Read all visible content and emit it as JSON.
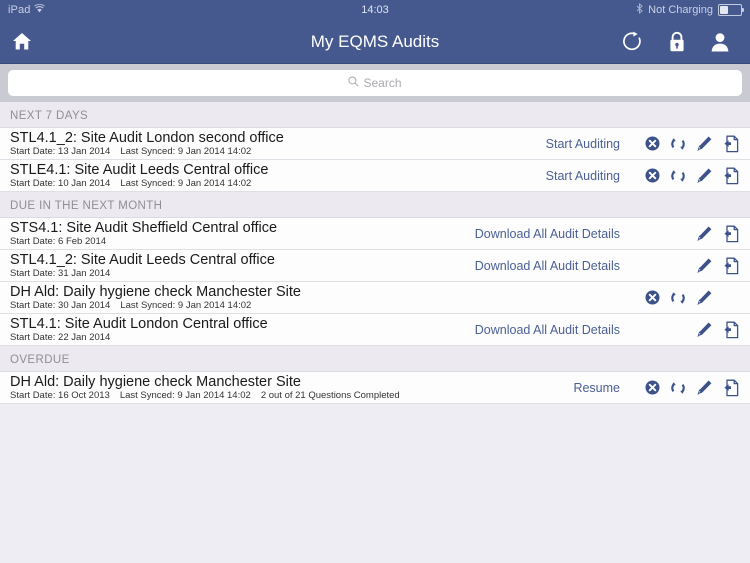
{
  "status_bar": {
    "device": "iPad",
    "wifi_icon": "wifi-icon",
    "time": "14:03",
    "bluetooth_icon": "bluetooth-icon",
    "charging_status": "Not Charging",
    "battery_icon": "battery-icon"
  },
  "nav": {
    "title": "My EQMS Audits",
    "home_icon": "home-icon",
    "refresh_icon": "refresh-icon",
    "lock_icon": "lock-icon",
    "user_icon": "user-icon"
  },
  "search": {
    "placeholder": "Search",
    "value": "",
    "icon": "search-icon"
  },
  "colors": {
    "navbar": "#45598f",
    "link": "#4a5f95",
    "icon": "#3d5289",
    "section_header_text": "#8e8e93",
    "page_background": "#eeedf3",
    "row_background": "#fdfdfd",
    "search_bar_background": "#c9cad2"
  },
  "sections": [
    {
      "title": "NEXT 7 DAYS",
      "rows": [
        {
          "title": "STL4.1_2: Site Audit London second office",
          "start_date": "Start Date: 13 Jan 2014",
          "last_synced": "Last  Synced: 9 Jan 2014 14:02",
          "progress": "",
          "action_label": "Start Auditing",
          "icons": [
            "cancel-icon",
            "sync-icon",
            "edit-icon",
            "download-document-icon"
          ]
        },
        {
          "title": "STLE4.1: Site Audit Leeds Central office",
          "start_date": "Start Date: 10 Jan 2014",
          "last_synced": "Last  Synced: 9 Jan 2014 14:02",
          "progress": "",
          "action_label": "Start Auditing",
          "icons": [
            "cancel-icon",
            "sync-icon",
            "edit-icon",
            "download-document-icon"
          ]
        }
      ]
    },
    {
      "title": "DUE IN THE NEXT MONTH",
      "rows": [
        {
          "title": "STS4.1: Site Audit Sheffield Central office",
          "start_date": "Start Date: 6 Feb 2014",
          "last_synced": "",
          "progress": "",
          "action_label": "Download All Audit Details",
          "icons": [
            "edit-icon",
            "download-document-icon"
          ]
        },
        {
          "title": "STL4.1_2: Site Audit Leeds Central office",
          "start_date": "Start Date: 31 Jan 2014",
          "last_synced": "",
          "progress": "",
          "action_label": "Download All Audit Details",
          "icons": [
            "edit-icon",
            "download-document-icon"
          ]
        },
        {
          "title": "DH Ald: Daily hygiene check Manchester Site",
          "start_date": "Start Date: 30 Jan 2014",
          "last_synced": "Last  Synced: 9 Jan 2014 14:02",
          "progress": "",
          "action_label": "",
          "icons": [
            "cancel-icon",
            "sync-icon",
            "edit-icon"
          ]
        },
        {
          "title": "STL4.1: Site Audit London Central office",
          "start_date": "Start Date: 22 Jan 2014",
          "last_synced": "",
          "progress": "",
          "action_label": "Download All Audit Details",
          "icons": [
            "edit-icon",
            "download-document-icon"
          ]
        }
      ]
    },
    {
      "title": "OVERDUE",
      "rows": [
        {
          "title": "DH Ald: Daily hygiene check Manchester Site",
          "start_date": "Start Date: 16 Oct 2013",
          "last_synced": "Last  Synced: 9 Jan 2014 14:02",
          "progress": "2 out of 21 Questions Completed",
          "action_label": "Resume",
          "icons": [
            "cancel-icon",
            "sync-icon",
            "edit-icon",
            "download-document-icon"
          ]
        }
      ]
    }
  ]
}
